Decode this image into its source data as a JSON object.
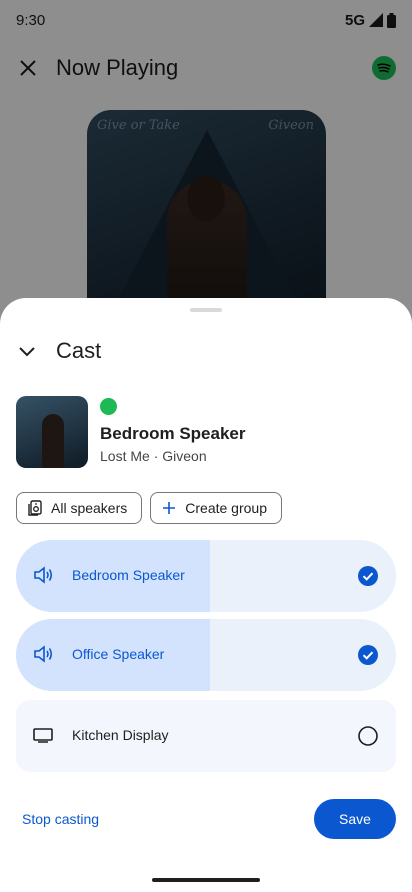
{
  "status_bar": {
    "time": "9:30",
    "network": "5G"
  },
  "background_screen": {
    "title": "Now Playing",
    "album_art_text_left": "Give or Take",
    "album_art_text_right": "Giveon"
  },
  "sheet": {
    "title": "Cast",
    "now_playing": {
      "device": "Bedroom Speaker",
      "track": "Lost Me · Giveon"
    },
    "chips": [
      {
        "label": "All speakers",
        "icon": "speaker-group-icon"
      },
      {
        "label": "Create group",
        "icon": "plus-icon"
      }
    ],
    "devices": [
      {
        "name": "Bedroom Speaker",
        "icon": "volume-icon",
        "selected": true,
        "volume_fraction": 0.51
      },
      {
        "name": "Office Speaker",
        "icon": "volume-icon",
        "selected": true,
        "volume_fraction": 0.51
      },
      {
        "name": "Kitchen Display",
        "icon": "tv-icon",
        "selected": false
      }
    ],
    "stop_label": "Stop casting",
    "save_label": "Save"
  },
  "colors": {
    "accent": "#0b57d0",
    "spotify": "#1db954",
    "selected_fill": "#d3e3fd",
    "selected_bg": "#eaf1fb"
  }
}
